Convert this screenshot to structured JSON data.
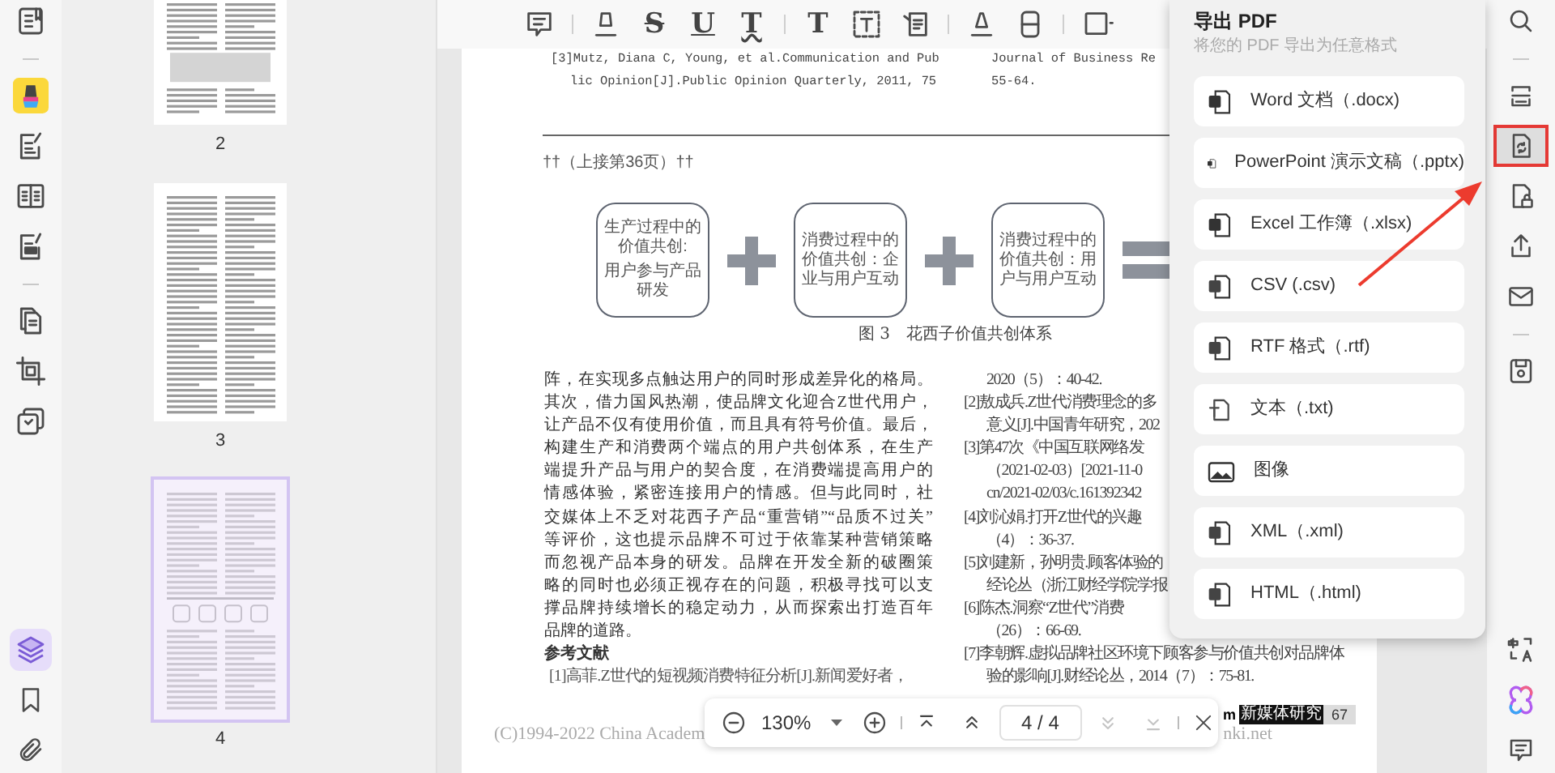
{
  "left_rail": {
    "top": [
      {
        "kind": "tool",
        "selected": false
      },
      {
        "kind": "divider"
      },
      {
        "kind": "tool",
        "selected": false
      },
      {
        "kind": "tool",
        "selected": false
      },
      {
        "kind": "tool",
        "selected": false
      },
      {
        "kind": "tool",
        "selected": false
      },
      {
        "kind": "divider"
      },
      {
        "kind": "tool",
        "selected": false
      },
      {
        "kind": "tool",
        "selected": false
      },
      {
        "kind": "tool",
        "selected": false
      }
    ],
    "bottom": [
      {
        "kind": "tool",
        "selected": true
      },
      {
        "kind": "tool",
        "selected": false
      },
      {
        "kind": "tool",
        "selected": false
      }
    ]
  },
  "thumbnails": [
    {
      "label": "2",
      "selected": false
    },
    {
      "label": "3",
      "selected": false
    },
    {
      "label": "4",
      "selected": true
    }
  ],
  "toolbar": [
    {
      "kind": "comment"
    },
    {
      "kind": "divider"
    },
    {
      "kind": "highlight"
    },
    {
      "kind": "strikethrough",
      "glyph": "S"
    },
    {
      "kind": "underline",
      "glyph": "U"
    },
    {
      "kind": "squiggly",
      "glyph": "T"
    },
    {
      "kind": "divider"
    },
    {
      "kind": "text",
      "glyph": "T"
    },
    {
      "kind": "textbox"
    },
    {
      "kind": "callout"
    },
    {
      "kind": "divider"
    },
    {
      "kind": "pencil"
    },
    {
      "kind": "eraser"
    },
    {
      "kind": "divider"
    },
    {
      "kind": "shape"
    }
  ],
  "document": {
    "top_refs_left": [
      {
        "text": "[3]Mutz, Diana C, Young, et al.Communication and Pub",
        "indent": false
      },
      {
        "text": "lic Opinion[J].Public Opinion Quarterly, 2011, 75",
        "indent": true
      }
    ],
    "top_refs_right": [
      "Journal of Business Re",
      "55-64."
    ],
    "continued_note": "††（上接第36页）††",
    "diagram": {
      "boxes": [
        {
          "paragraphs": [
            "生产过程中的价值共创:",
            "用户参与产品研发"
          ]
        },
        {
          "paragraphs": [
            "消费过程中的价值共创：企业与用户互动"
          ]
        },
        {
          "paragraphs": [
            "消费过程中的价值共创：用户与用户互动"
          ]
        }
      ],
      "caption": "图 3　花西子价值共创体系"
    },
    "body_lines": [
      {
        "text": "阵，在实现多点触达用户的同时形成差异化的格局。",
        "kind": "line"
      },
      {
        "text": "其次，借力国风热潮，使品牌文化迎合Z世代用户，",
        "kind": "line"
      },
      {
        "text": "让产品不仅有使用价值，而且具有符号价值。最后，",
        "kind": "line"
      },
      {
        "text": "构建生产和消费两个端点的用户共创体系，在生产",
        "kind": "line"
      },
      {
        "text": "端提升产品与用户的契合度，在消费端提高用户的",
        "kind": "line"
      },
      {
        "text": "情感体验，紧密连接用户的情感。但与此同时，社",
        "kind": "line"
      },
      {
        "text": "交媒体上不乏对花西子产品“重营销”“品质不过关”",
        "kind": "line"
      },
      {
        "text": "等评价，这也提示品牌不可过于依靠某种营销策略",
        "kind": "line"
      },
      {
        "text": "而忽视产品本身的研发。品牌在开发全新的破圈策",
        "kind": "line"
      },
      {
        "text": "略的同时也必须正视存在的问题，积极寻找可以支",
        "kind": "line"
      },
      {
        "text": "撑品牌持续增长的稳定动力，从而探索出打造百年",
        "kind": "line"
      },
      {
        "text": "品牌的道路。",
        "kind": "last"
      },
      {
        "text": "参考文献",
        "kind": "heading"
      },
      {
        "text": "[1]高菲.Z世代的短视频消费特征分析[J].新闻爱好者，",
        "kind": "ref"
      }
    ],
    "right_refs": [
      {
        "text": "2020（5）：40-42.",
        "indent": true
      },
      {
        "text": "[2]敖成兵.Z世代消费理念的多",
        "indent": false
      },
      {
        "text": "意义[J].中国青年研究，202",
        "indent": true
      },
      {
        "text": "[3]第47次《中国互联网络发",
        "indent": false
      },
      {
        "text": "（2021-02-03）[2021-11-0",
        "indent": true
      },
      {
        "text": "cn/2021-02/03/c.161392342",
        "indent": true
      },
      {
        "text": "[4]刘沁娟.打开Z世代的兴趣",
        "indent": false
      },
      {
        "text": "（4）：36-37.",
        "indent": true
      },
      {
        "text": "[5]刘建新，孙明贵.顾客体验的",
        "indent": false
      },
      {
        "text": "经论丛（浙江财经学院学报",
        "indent": true
      },
      {
        "text": "[6]陈杰.洞察“Z世代”消费",
        "indent": false
      },
      {
        "text": "（26）：66-69.",
        "indent": true
      },
      {
        "text": "[7]李朝辉.虚拟品牌社区环境下顾客参与价值共创对品牌体",
        "indent": false
      },
      {
        "text": "验的影响[J].财经论丛，2014（7）：75-81.",
        "indent": true
      }
    ],
    "header_fragment": "m",
    "journal_badge": "新媒体研究",
    "page_number": "67",
    "footer_copyright": "(C)1994-2022 China Academ",
    "footer_site": "nki.net"
  },
  "export_panel": {
    "title": "导出 PDF",
    "subtitle": "将您的 PDF 导出为任意格式",
    "options": [
      {
        "label": "Word 文档（.docx)",
        "kind": "word"
      },
      {
        "label": "PowerPoint 演示文稿（.pptx)",
        "kind": "powerpoint"
      },
      {
        "label": "Excel 工作簿（.xlsx)",
        "kind": "excel"
      },
      {
        "label": "CSV (.csv)",
        "kind": "csv"
      },
      {
        "label": "RTF 格式（.rtf)",
        "kind": "rtf"
      },
      {
        "label": "文本（.txt)",
        "kind": "txt"
      },
      {
        "label": "图像",
        "kind": "image"
      },
      {
        "label": "XML（.xml)",
        "kind": "xml"
      },
      {
        "label": "HTML（.html)",
        "kind": "html"
      }
    ]
  },
  "right_rail": {
    "top": [
      {
        "kind": "tool",
        "selected": false,
        "highlighted": false
      },
      {
        "kind": "divider"
      },
      {
        "kind": "tool",
        "selected": false,
        "highlighted": false
      },
      {
        "kind": "tool",
        "selected": true,
        "highlighted": true
      },
      {
        "kind": "tool",
        "selected": false,
        "highlighted": false
      },
      {
        "kind": "tool",
        "selected": false,
        "highlighted": false
      },
      {
        "kind": "tool",
        "selected": false,
        "highlighted": false
      },
      {
        "kind": "divider"
      },
      {
        "kind": "tool",
        "selected": false,
        "highlighted": false
      }
    ],
    "bottom": [
      {
        "kind": "tool",
        "selected": false,
        "highlighted": false
      },
      {
        "kind": "tool",
        "selected": false,
        "highlighted": false
      },
      {
        "kind": "tool",
        "selected": false,
        "highlighted": false
      }
    ]
  },
  "page_nav": {
    "zoom": "130%",
    "page": "4 / 4",
    "buttons": [
      {
        "kind": "first",
        "disabled": false
      },
      {
        "kind": "prev",
        "disabled": false
      },
      {
        "kind": "next",
        "disabled": true
      },
      {
        "kind": "last",
        "disabled": true
      }
    ]
  }
}
